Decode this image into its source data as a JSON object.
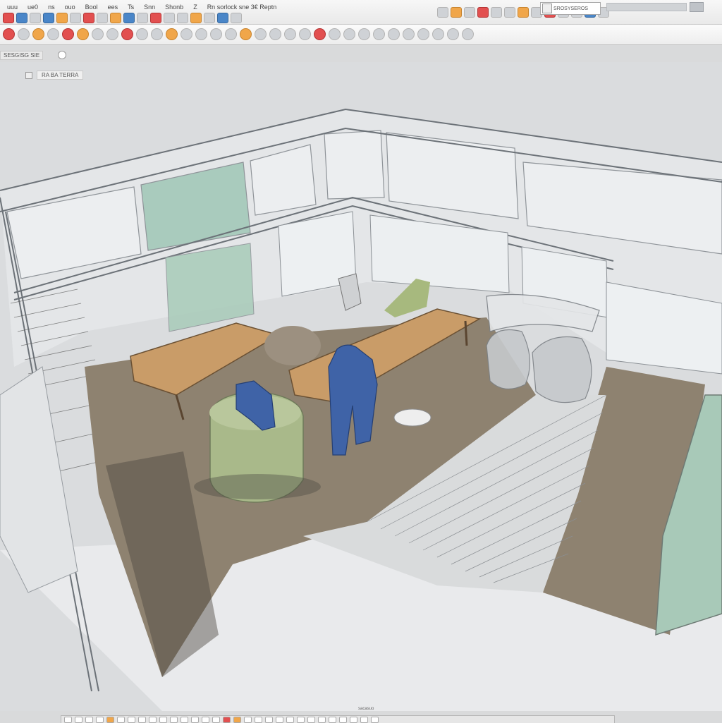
{
  "menubar": {
    "items": [
      {
        "label": "uuu",
        "name": "menu-item-1"
      },
      {
        "label": "ue0"
      },
      {
        "label": "ns"
      },
      {
        "label": "ouo"
      },
      {
        "label": "Bool"
      },
      {
        "label": "ees"
      },
      {
        "label": "Ts"
      },
      {
        "label": "Snn"
      },
      {
        "label": "Shonb"
      },
      {
        "label": "Z"
      }
    ],
    "title_text": "Rn sorlock sne 3€ Reptn"
  },
  "toolbar1": {
    "icons": [
      "red",
      "blue",
      "gray",
      "blue",
      "orange",
      "gray",
      "red",
      "gray",
      "orange",
      "blue",
      "gray",
      "red",
      "gray",
      "gray",
      "orange",
      "gray",
      "blue",
      "gray"
    ]
  },
  "right_tools": {
    "icons": [
      "gray",
      "orange",
      "gray",
      "red",
      "gray",
      "gray",
      "orange",
      "gray",
      "red",
      "gray",
      "gray",
      "blue",
      "gray"
    ],
    "box_label": "SROSYSEROS"
  },
  "toolbar2": {
    "icons": [
      "red",
      "gray",
      "orange",
      "gray",
      "red",
      "orange",
      "gray",
      "gray",
      "red",
      "gray",
      "gray",
      "orange",
      "gray",
      "gray",
      "gray",
      "gray",
      "orange",
      "gray",
      "gray",
      "gray",
      "gray",
      "red",
      "gray",
      "gray",
      "gray",
      "gray",
      "gray",
      "gray",
      "gray",
      "gray",
      "gray",
      "gray"
    ]
  },
  "status": {
    "label": "SESGISG SIE"
  },
  "breadcrumb": {
    "label": "RA BA TERRA"
  },
  "bottombar": {
    "icons": [
      "gray",
      "gray",
      "gray",
      "gray",
      "o",
      "gray",
      "gray",
      "gray",
      "gray",
      "gray",
      "gray",
      "gray",
      "gray",
      "gray",
      "gray",
      "r",
      "o",
      "gray",
      "gray",
      "gray",
      "gray",
      "gray",
      "gray",
      "gray",
      "gray",
      "gray",
      "gray",
      "gray",
      "gray",
      "gray"
    ],
    "label": "sacasuo"
  },
  "colors": {
    "floor": "#8e8270",
    "table_wood": "#c99c68",
    "figure_blue": "#3f63a7",
    "pouf_green": "#a9b98a",
    "glass": "#9cc6b2",
    "ground": "#e6e8ea"
  }
}
